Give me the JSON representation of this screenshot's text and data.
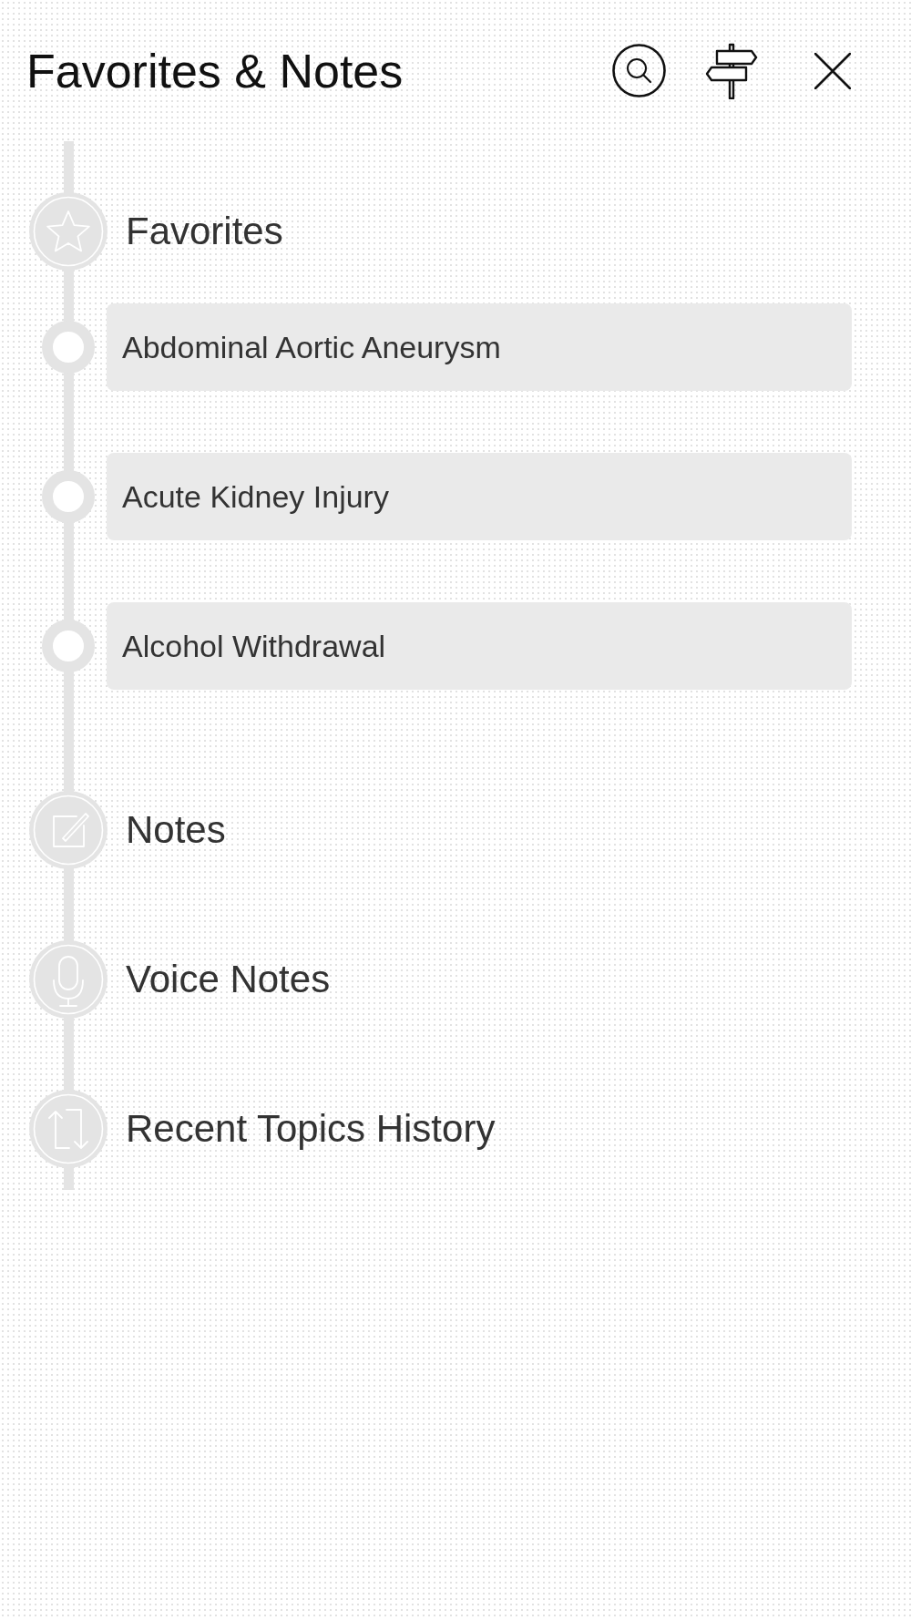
{
  "header": {
    "title": "Favorites & Notes"
  },
  "sections": [
    {
      "kind": "favorites",
      "label": "Favorites",
      "items": [
        {
          "label": "Abdominal Aortic Aneurysm"
        },
        {
          "label": "Acute Kidney Injury"
        },
        {
          "label": "Alcohol Withdrawal"
        }
      ]
    },
    {
      "kind": "notes",
      "label": "Notes"
    },
    {
      "kind": "voice_notes",
      "label": "Voice Notes"
    },
    {
      "kind": "history",
      "label": "Recent Topics History"
    }
  ]
}
